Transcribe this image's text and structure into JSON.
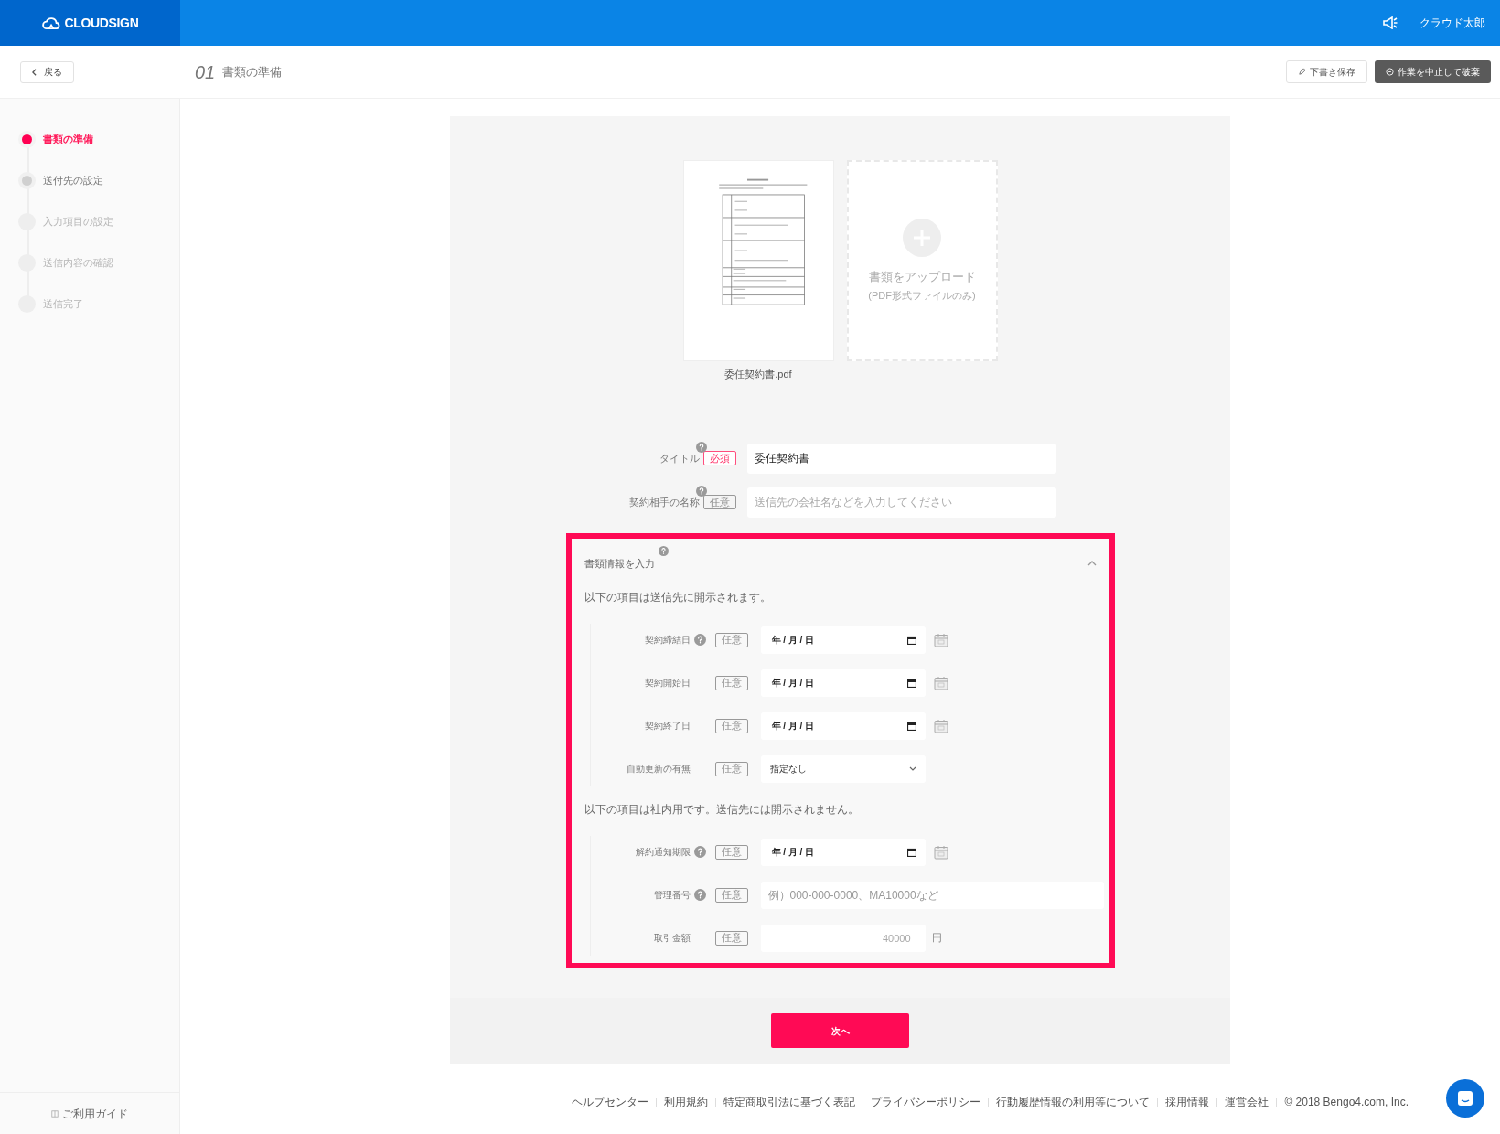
{
  "header": {
    "logo": "CLOUDSIGN",
    "user": "クラウド太郎"
  },
  "toolbar": {
    "back": "戻る",
    "step_number": "01",
    "step_title": "書類の準備",
    "buttons": [
      {
        "label": "下書き保存",
        "kind": "secondary"
      },
      {
        "label": "作業を中止して破棄",
        "kind": "danger"
      }
    ]
  },
  "steps": [
    {
      "label": "書類の準備",
      "selected": true,
      "disabled": false
    },
    {
      "label": "送付先の設定",
      "selected": false,
      "disabled": false
    },
    {
      "label": "入力項目の設定",
      "selected": false,
      "disabled": true
    },
    {
      "label": "送信内容の確認",
      "selected": false,
      "disabled": true
    },
    {
      "label": "送信完了",
      "selected": false,
      "disabled": true
    }
  ],
  "documents": {
    "file": {
      "name": "委任契約書.pdf"
    },
    "upload": {
      "label": "書類をアップロード",
      "note": "(PDF形式ファイルのみ)"
    }
  },
  "fields": [
    {
      "label": "タイトル",
      "help": true,
      "tag": {
        "text": "必須",
        "required": true
      },
      "value": "委任契約書"
    },
    {
      "label": "契約相手の名称",
      "help": true,
      "tag": {
        "text": "任意",
        "required": false
      },
      "placeholder": "送信先の会社名などを入力してください"
    }
  ],
  "section": {
    "title": "書類情報を入力",
    "help": true,
    "expanded": true,
    "groups": [
      {
        "note": "以下の項目は送信先に開示されます。",
        "rows": [
          {
            "label": "契約締結日",
            "help": true,
            "tag": "任意",
            "kind": "date",
            "value": "年 / 月 / 日"
          },
          {
            "label": "契約開始日",
            "help": false,
            "tag": "任意",
            "kind": "date",
            "value": "年 / 月 / 日"
          },
          {
            "label": "契約終了日",
            "help": false,
            "tag": "任意",
            "kind": "date",
            "value": "年 / 月 / 日"
          },
          {
            "label": "自動更新の有無",
            "help": false,
            "tag": "任意",
            "kind": "select",
            "value": "指定なし"
          }
        ]
      },
      {
        "note": "以下の項目は社内用です。送信先には開示されません。",
        "rows": [
          {
            "label": "解約通知期限",
            "help": true,
            "tag": "任意",
            "kind": "date",
            "value": "年 / 月 / 日"
          },
          {
            "label": "管理番号",
            "help": true,
            "tag": "任意",
            "kind": "text",
            "placeholder": "例）000-000-0000、MA10000など"
          },
          {
            "label": "取引金額",
            "help": false,
            "tag": "任意",
            "kind": "amount",
            "placeholder": "40000",
            "unit": "円"
          }
        ]
      }
    ]
  },
  "next_button": "次へ",
  "guide": "ご利用ガイド",
  "footer": {
    "links": [
      "ヘルプセンター",
      "利用規約",
      "特定商取引法に基づく表記",
      "プライバシーポリシー",
      "行動履歴情報の利用等について",
      "採用情報",
      "運営会社"
    ],
    "copyright": "© 2018 Bengo4.com, Inc."
  }
}
